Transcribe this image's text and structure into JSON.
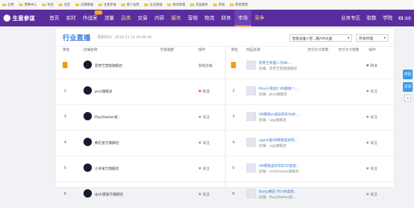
{
  "bookmarks": [
    "应用",
    "营销中心",
    "淘宝",
    "社区",
    "店铺管理",
    "生意参谋",
    "客户运营",
    "企业管理",
    "物流管理",
    "货品服务",
    "其他",
    "跨境营销"
  ],
  "nav": {
    "brand": "生意参谋",
    "items": [
      "首页",
      "实时",
      "作战室",
      "流量",
      "品类",
      "交易",
      "内容",
      "服务",
      "营销",
      "物流",
      "财务",
      "市场",
      "竞争"
    ],
    "right": [
      "业务专区",
      "取数",
      "学院"
    ],
    "message": "消息"
  },
  "panel": {
    "title": "行业直播",
    "time": "更新时间：2018-11-11 00:06:40",
    "dropdown_category": "智能设备>智...路/VR头盔",
    "dropdown_terminal": "所有终端",
    "left_headers": [
      "排名",
      "店铺名称",
      "交易指数",
      "操作"
    ],
    "right_headers": [
      "排名",
      "商品名称",
      "支付子订单数",
      "支付子订单数",
      "操作"
    ],
    "left_rows": [
      {
        "rank": "1",
        "name": "爱奇艺智能旗舰店",
        "op": "我有店铺",
        "medal": true
      },
      {
        "rank": "2",
        "name": "pico旗舰店",
        "op": "取消",
        "fav": true
      },
      {
        "rank": "3",
        "name": "PlayStation官...",
        "op": "关注"
      },
      {
        "rank": "4",
        "name": "索尼官方旗舰店",
        "op": "关注"
      },
      {
        "rank": "5",
        "name": "小米官方旗舰店",
        "op": "关注"
      },
      {
        "rank": "6",
        "name": "dji大疆官方旗舰店",
        "op": "关注"
      }
    ],
    "right_rows": [
      {
        "rank": "1",
        "name": "爱奇艺奇遇二代4K...",
        "shop": "店铺：爱奇艺智能旗舰店",
        "op": "取消",
        "fav": true,
        "medal": true
      },
      {
        "rank": "2",
        "name": "Pico小怪兽2 VR眼镜一...",
        "shop": "店铺：pico旗舰店",
        "op": "关注"
      },
      {
        "rank": "3",
        "name": "VR眼镜vr虚拟现实3d手...",
        "shop": "店铺：ugp旗舰店",
        "op": "关注"
      },
      {
        "rank": "4",
        "name": "ugp头盔VR眼镜虚拟现...",
        "shop": "店铺：ugp旗舰店",
        "op": "关注"
      },
      {
        "rank": "5",
        "name": "VR眼镜虚拟现实3D智能...",
        "shop": "店铺：vrshinecon旗舰店",
        "op": "关注"
      },
      {
        "rank": "6",
        "name": "Sony/索尼 PS VR虚拟...",
        "shop": "店铺：PlayStation官...",
        "op": "关注"
      }
    ]
  },
  "side": {
    "btn1": "体验",
    "btn2": "反馈",
    "close": "×"
  }
}
